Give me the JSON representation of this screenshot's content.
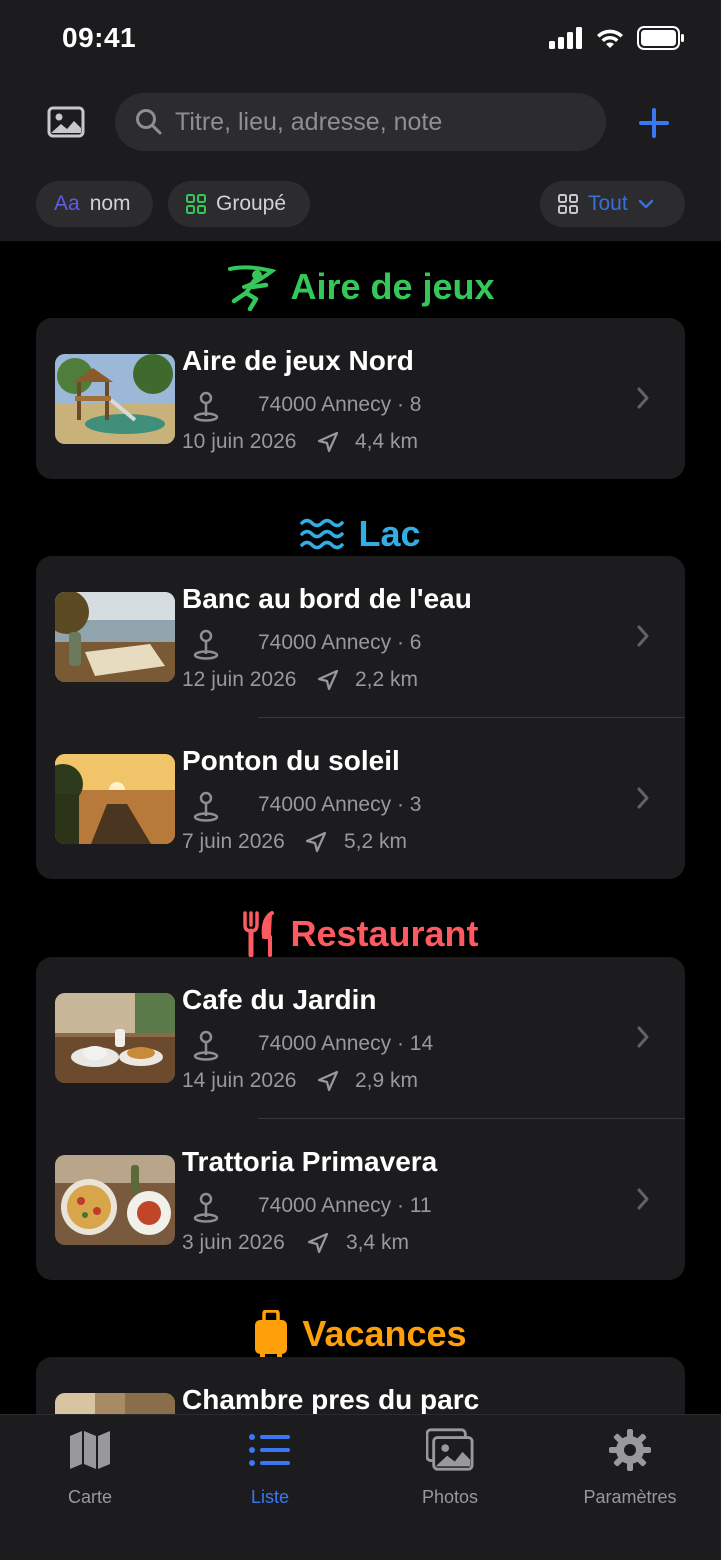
{
  "status": {
    "time": "09:41"
  },
  "search": {
    "placeholder": "Titre, lieu, adresse, note"
  },
  "chips": {
    "sort_prefix": "Aa",
    "sort_label": "nom",
    "group_label": "Groupé",
    "filter_label": "Tout"
  },
  "colors": {
    "accent": "#3a78f2",
    "aire": "#34c759",
    "lac": "#32ade6",
    "restaurant": "#ff5a5f",
    "vacances": "#ff9f0a"
  },
  "sections": [
    {
      "title": "Aire de jeux",
      "icon": "playground-icon",
      "items": [
        {
          "title": "Aire de jeux Nord",
          "address": "74000 Annecy · 8",
          "date": "10 juin 2026",
          "distance": "4,4 km"
        }
      ]
    },
    {
      "title": "Lac",
      "icon": "water-waves-icon",
      "items": [
        {
          "title": "Banc au bord de l'eau",
          "address": "74000 Annecy · 6",
          "date": "12 juin 2026",
          "distance": "2,2 km"
        },
        {
          "title": "Ponton du soleil",
          "address": "74000 Annecy · 3",
          "date": "7 juin 2026",
          "distance": "5,2 km"
        }
      ]
    },
    {
      "title": "Restaurant",
      "icon": "fork-knife-icon",
      "items": [
        {
          "title": "Cafe du Jardin",
          "address": "74000 Annecy · 14",
          "date": "14 juin 2026",
          "distance": "2,9 km"
        },
        {
          "title": "Trattoria Primavera",
          "address": "74000 Annecy · 11",
          "date": "3 juin 2026",
          "distance": "3,4 km"
        }
      ]
    },
    {
      "title": "Vacances",
      "icon": "suitcase-icon",
      "items": [
        {
          "title": "Chambre pres du parc"
        }
      ]
    }
  ],
  "tabs": [
    {
      "label": "Carte",
      "icon": "map-icon"
    },
    {
      "label": "Liste",
      "icon": "list-icon"
    },
    {
      "label": "Photos",
      "icon": "photos-icon"
    },
    {
      "label": "Paramètres",
      "icon": "gear-icon"
    }
  ]
}
